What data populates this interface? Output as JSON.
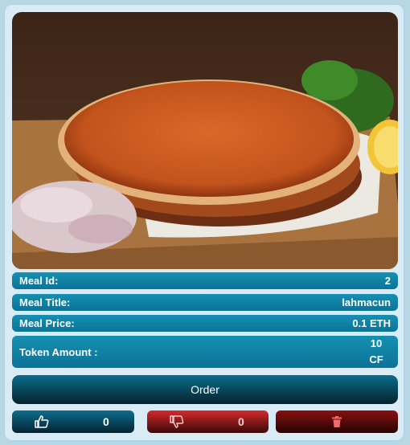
{
  "meal": {
    "id_label": "Meal Id:",
    "id_value": "2",
    "title_label": "Meal Title:",
    "title_value": "lahmacun",
    "price_label": "Meal Price:",
    "price_value": "0.1 ETH",
    "token_label": "Token Amount :",
    "token_value_line1": "10",
    "token_value_line2": "CF"
  },
  "actions": {
    "order_label": "Order",
    "likes": "0",
    "dislikes": "0"
  },
  "colors": {
    "row": "#0e7fa3",
    "like": "#0b5770",
    "dislike": "#b31e1e",
    "delete": "#6e0c0c"
  },
  "icons": [
    "thumbs-up-icon",
    "thumbs-down-icon",
    "trash-icon"
  ]
}
